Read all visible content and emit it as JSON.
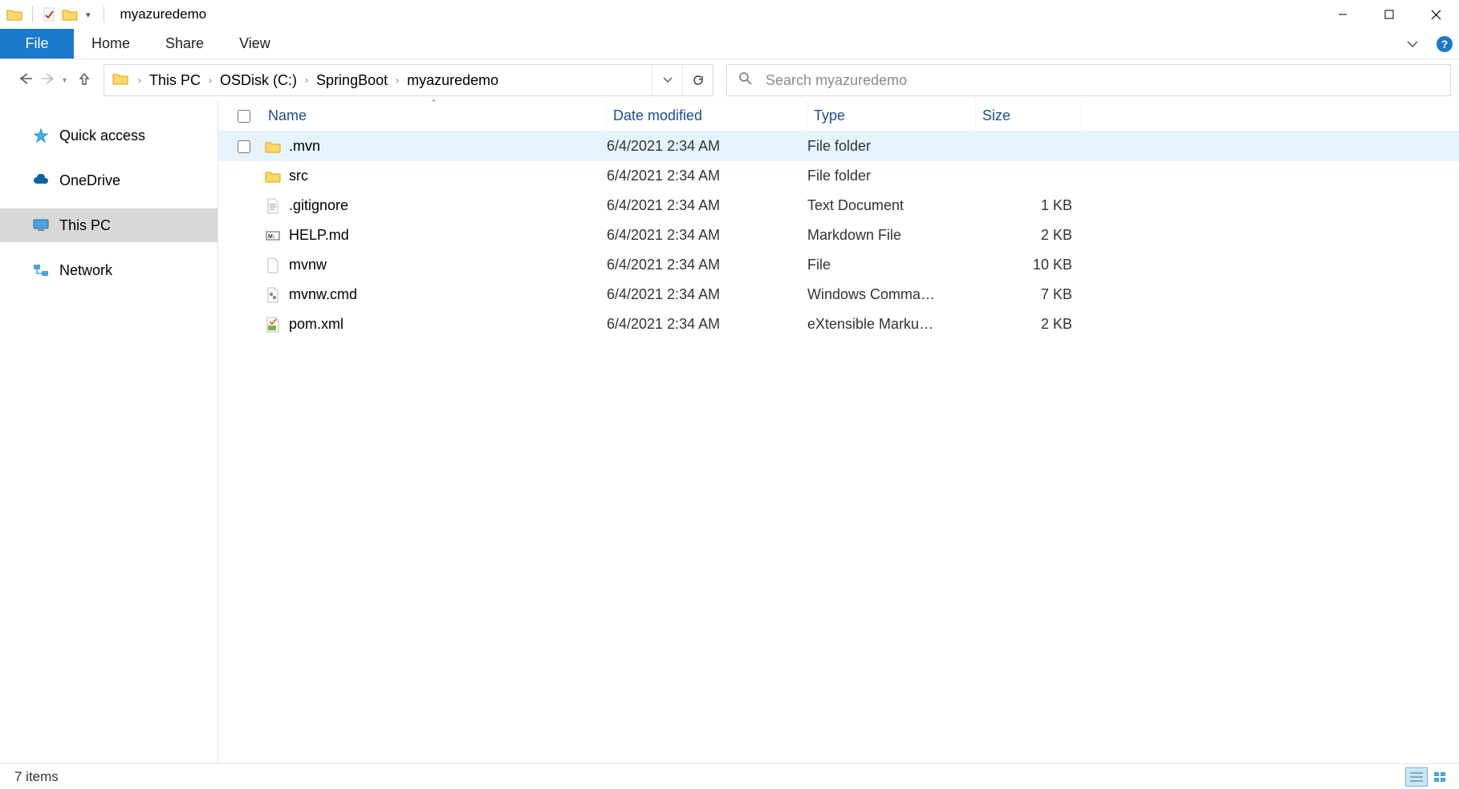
{
  "window": {
    "title": "myazuredemo"
  },
  "ribbon": {
    "file": "File",
    "tabs": [
      "Home",
      "Share",
      "View"
    ]
  },
  "breadcrumbs": [
    "This PC",
    "OSDisk (C:)",
    "SpringBoot",
    "myazuredemo"
  ],
  "search": {
    "placeholder": "Search myazuredemo"
  },
  "sidebar": {
    "items": [
      {
        "label": "Quick access",
        "icon": "star"
      },
      {
        "label": "OneDrive",
        "icon": "cloud"
      },
      {
        "label": "This PC",
        "icon": "pc",
        "selected": true
      },
      {
        "label": "Network",
        "icon": "network"
      }
    ]
  },
  "columns": {
    "name": "Name",
    "date": "Date modified",
    "type": "Type",
    "size": "Size"
  },
  "rows": [
    {
      "name": ".mvn",
      "date": "6/4/2021 2:34 AM",
      "type": "File folder",
      "size": "",
      "icon": "folder",
      "hover": true
    },
    {
      "name": "src",
      "date": "6/4/2021 2:34 AM",
      "type": "File folder",
      "size": "",
      "icon": "folder"
    },
    {
      "name": ".gitignore",
      "date": "6/4/2021 2:34 AM",
      "type": "Text Document",
      "size": "1 KB",
      "icon": "text"
    },
    {
      "name": "HELP.md",
      "date": "6/4/2021 2:34 AM",
      "type": "Markdown File",
      "size": "2 KB",
      "icon": "md"
    },
    {
      "name": "mvnw",
      "date": "6/4/2021 2:34 AM",
      "type": "File",
      "size": "10 KB",
      "icon": "file"
    },
    {
      "name": "mvnw.cmd",
      "date": "6/4/2021 2:34 AM",
      "type": "Windows Comma…",
      "size": "7 KB",
      "icon": "cmd"
    },
    {
      "name": "pom.xml",
      "date": "6/4/2021 2:34 AM",
      "type": "eXtensible Marku…",
      "size": "2 KB",
      "icon": "xml"
    }
  ],
  "status": {
    "count": "7 items"
  }
}
